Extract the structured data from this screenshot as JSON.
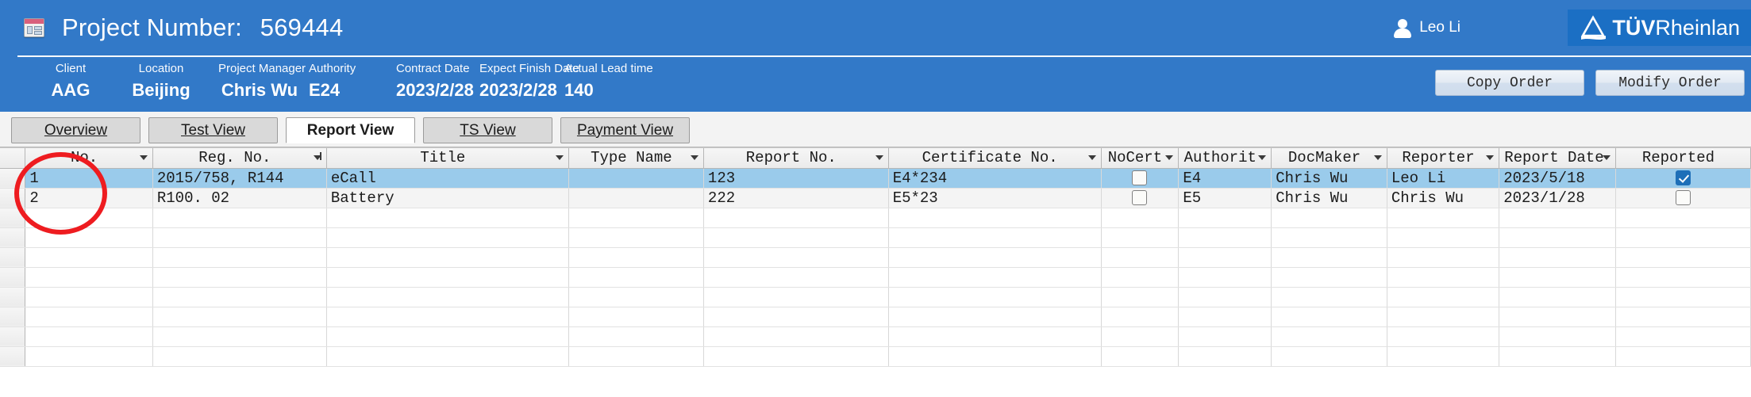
{
  "header": {
    "app_icon": "window-list-icon",
    "title_label": "Project Number:",
    "project_number": "569444",
    "user": {
      "icon": "user-avatar-icon",
      "name": "Leo Li"
    },
    "brand": {
      "icon": "tuv-triangle-logo",
      "bold": "TÜV",
      "light": "Rheinlan"
    },
    "accent_blue": "#3279c8",
    "brand_blue": "#1b6fc4"
  },
  "info_fields": [
    {
      "label": "Client",
      "value": "AAG"
    },
    {
      "label": "Location",
      "value": "Beijing"
    },
    {
      "label": "Project Manager",
      "value": "Chris Wu"
    },
    {
      "label": "Authority",
      "value": "E24"
    },
    {
      "label": "Contract Date",
      "value": "2023/2/28"
    },
    {
      "label": "Expect Finish Date",
      "value": "2023/2/28"
    },
    {
      "label": "Actual Lead time",
      "value": "140"
    }
  ],
  "order_buttons": [
    {
      "label": "Copy Order"
    },
    {
      "label": "Modify Order"
    }
  ],
  "tabs": [
    {
      "label": "Overview",
      "active": false
    },
    {
      "label": "Test View",
      "active": false
    },
    {
      "label": "Report View",
      "active": true
    },
    {
      "label": "TS View",
      "active": false
    },
    {
      "label": "Payment View",
      "active": false
    }
  ],
  "table": {
    "columns": [
      {
        "label": "No.",
        "filtered": false
      },
      {
        "label": "Reg. No.",
        "filtered": true
      },
      {
        "label": "Title",
        "filtered": false
      },
      {
        "label": "Type Name",
        "filtered": false
      },
      {
        "label": "Report No.",
        "filtered": false
      },
      {
        "label": "Certificate No.",
        "filtered": false
      },
      {
        "label": "NoCert",
        "filtered": false
      },
      {
        "label": "Authorit",
        "filtered": false
      },
      {
        "label": "DocMaker",
        "filtered": false
      },
      {
        "label": "Reporter",
        "filtered": false
      },
      {
        "label": "Report Date",
        "filtered": false
      },
      {
        "label": "Reported",
        "filtered": false
      }
    ],
    "rows": [
      {
        "no": "1",
        "reg_no": "2015/758, R144",
        "title": "eCall",
        "type_name": "",
        "report_no": "123",
        "certificate_no": "E4*234",
        "nocert": false,
        "authority": "E4",
        "docmaker": "Chris Wu",
        "reporter": "Leo Li",
        "report_date": "2023/5/18",
        "reported": true
      },
      {
        "no": "2",
        "reg_no": "R100. 02",
        "title": "Battery",
        "type_name": "",
        "report_no": "222",
        "certificate_no": "E5*23",
        "nocert": false,
        "authority": "E5",
        "docmaker": "Chris Wu",
        "reporter": "Chris Wu",
        "report_date": "2023/1/28",
        "reported": false
      }
    ]
  },
  "annotation": {
    "shape": "red-ellipse-highlight",
    "color": "#ee1c20",
    "target": "No. column"
  }
}
